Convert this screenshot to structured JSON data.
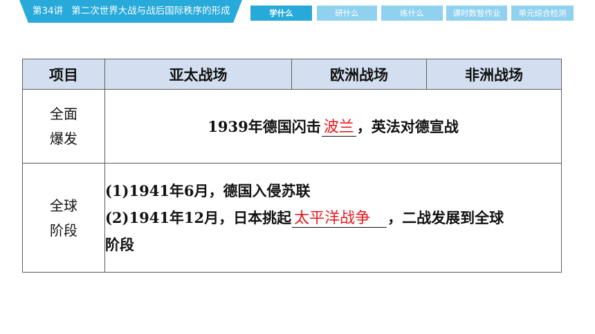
{
  "header": {
    "lesson": "第34讲",
    "chapter_title": "第二次世界大战与战后国际秩序的形成",
    "tabs": [
      {
        "label": "学什么",
        "active": true
      },
      {
        "label": "研什么",
        "active": false
      },
      {
        "label": "练什么",
        "active": false
      },
      {
        "label": "课时数智作业",
        "active": false
      },
      {
        "label": "单元综合检测",
        "active": false
      }
    ],
    "colors": {
      "accent": "#27A9DA",
      "tab_inactive": "#8FD1EE"
    }
  },
  "table": {
    "headers": [
      "项目",
      "亚太战场",
      "欧洲战场",
      "非洲战场"
    ],
    "header_bg": "#D3DFF0",
    "rows": [
      {
        "label_line1": "全面",
        "label_line2": "爆发",
        "text_before": "1939年德国闪击",
        "answer": "波兰",
        "text_after": "，英法对德宣战"
      },
      {
        "label_line1": "全球",
        "label_line2": "阶段",
        "line1": "(1)1941年6月，德国入侵苏联",
        "line2_before": "(2)1941年12月，日本挑起",
        "line2_answer": "太平洋战争",
        "line2_after": "，二战发展到全球",
        "line3": "阶段"
      }
    ],
    "answer_color": "#E8181D"
  }
}
